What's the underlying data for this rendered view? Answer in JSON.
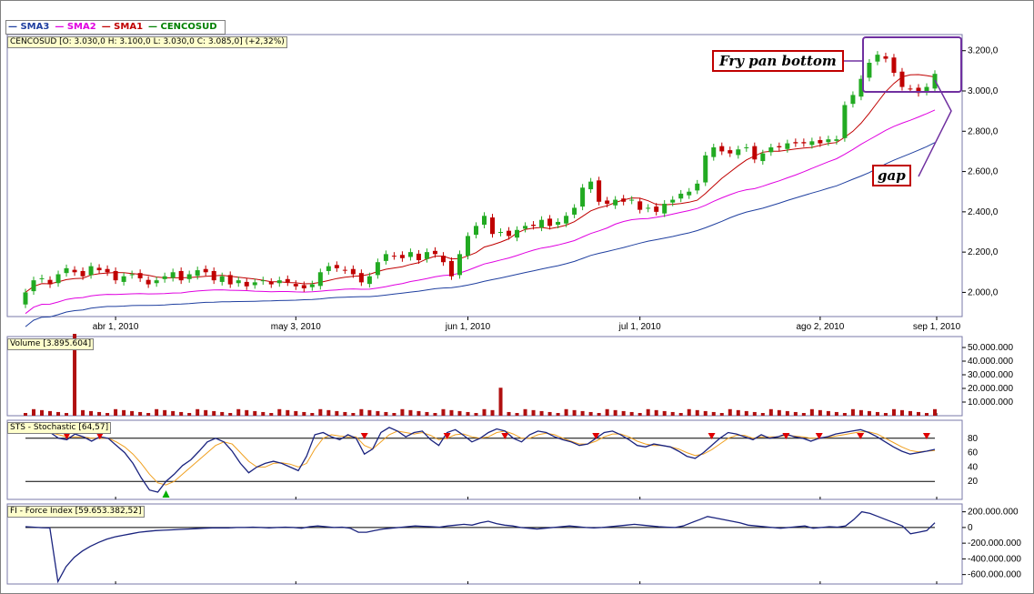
{
  "legend": [
    {
      "label": "SMA3",
      "color": "#1f3f9f"
    },
    {
      "label": "SMA2",
      "color": "#e000e0"
    },
    {
      "label": "SMA1",
      "color": "#c00000"
    },
    {
      "label": "CENCOSUD",
      "color": "#008000"
    }
  ],
  "panels": {
    "price_title": "CENCOSUD [O: 3.030,0  H: 3.100,0  L: 3.030,0  C: 3.085,0] (+2,32%)",
    "volume_title": "Volume [3.895.604]",
    "stoch_title": "STS - Stochastic [64,57]",
    "force_title": "FI - Force Index [59.653.382,52]"
  },
  "annotations": {
    "fry_pan": "Fry pan bottom",
    "gap": "gap"
  },
  "colors": {
    "up": "#22aa22",
    "down": "#c00000",
    "sma1": "#c00000",
    "sma2": "#e000e0",
    "sma3": "#1f3f9f",
    "stoch_k": "#1a237e",
    "stoch_d": "#f0a020",
    "force": "#1a237e",
    "volume": "#b01010",
    "annot_box": "#7030a0"
  },
  "chart_data": [
    {
      "type": "candlestick",
      "x_tick_labels": [
        "abr 1, 2010",
        "may 3, 2010",
        "jun 1, 2010",
        "jul 1, 2010",
        "ago 2, 2010",
        "sep 1, 2010"
      ],
      "y_tick_labels": [
        "2.000,0",
        "2.200,0",
        "2.400,0",
        "2.600,0",
        "2.800,0",
        "3.000,0",
        "3.200,0"
      ],
      "ylim": [
        1880,
        3280
      ],
      "closes": [
        2000,
        2060,
        2070,
        2040,
        2090,
        2120,
        2100,
        2080,
        2130,
        2110,
        2100,
        2060,
        2080,
        2090,
        2070,
        2040,
        2060,
        2080,
        2100,
        2060,
        2090,
        2110,
        2100,
        2060,
        2080,
        2040,
        2060,
        2030,
        2050,
        2060,
        2040,
        2060,
        2050,
        2030,
        2020,
        2040,
        2100,
        2130,
        2120,
        2110,
        2090,
        2050,
        2080,
        2150,
        2190,
        2180,
        2170,
        2200,
        2160,
        2200,
        2190,
        2150,
        2080,
        2190,
        2280,
        2330,
        2380,
        2290,
        2300,
        2280,
        2310,
        2330,
        2330,
        2360,
        2330,
        2350,
        2380,
        2420,
        2520,
        2550,
        2450,
        2440,
        2460,
        2450,
        2460,
        2410,
        2420,
        2400,
        2440,
        2460,
        2490,
        2500,
        2540,
        2680,
        2720,
        2700,
        2690,
        2710,
        2720,
        2660,
        2690,
        2720,
        2720,
        2740,
        2740,
        2740,
        2750,
        2740,
        2760,
        2760,
        2930,
        2980,
        3060,
        3140,
        3180,
        3160,
        3090,
        3020,
        3010,
        2990,
        3020,
        3085
      ],
      "volume_unit": "shares",
      "volume_ylim": [
        0,
        58000000
      ],
      "volume_tick_labels": [
        "10.000.000",
        "20.000.000",
        "30.000.000",
        "40.000.000",
        "50.000.000"
      ],
      "volume_spikes": [
        {
          "index": 6,
          "value": 60000000
        },
        {
          "index": 58,
          "value": 20500000
        }
      ],
      "stoch_ylim": [
        0,
        100
      ],
      "stoch_tick_labels": [
        "20",
        "40",
        "60",
        "80"
      ],
      "stoch_k": [
        95,
        93,
        90,
        88,
        80,
        78,
        86,
        82,
        76,
        82,
        80,
        70,
        60,
        45,
        25,
        8,
        5,
        20,
        30,
        42,
        50,
        62,
        75,
        80,
        75,
        62,
        45,
        32,
        40,
        45,
        48,
        45,
        40,
        35,
        55,
        85,
        88,
        82,
        78,
        85,
        80,
        58,
        65,
        88,
        95,
        90,
        82,
        88,
        90,
        78,
        70,
        88,
        92,
        84,
        75,
        80,
        88,
        93,
        90,
        80,
        75,
        85,
        90,
        88,
        82,
        78,
        75,
        70,
        72,
        80,
        88,
        90,
        85,
        78,
        70,
        68,
        72,
        70,
        68,
        62,
        55,
        52,
        60,
        70,
        80,
        88,
        86,
        82,
        78,
        85,
        80,
        82,
        86,
        82,
        80,
        76,
        80,
        82,
        86,
        88,
        90,
        92,
        88,
        82,
        75,
        68,
        62,
        58,
        60,
        62,
        64.57
      ],
      "stoch_d": [
        94,
        92,
        90,
        88,
        85,
        82,
        82,
        82,
        80,
        80,
        80,
        75,
        68,
        58,
        45,
        30,
        18,
        15,
        20,
        30,
        40,
        50,
        60,
        70,
        75,
        72,
        60,
        48,
        40,
        40,
        45,
        46,
        44,
        40,
        45,
        65,
        80,
        85,
        83,
        82,
        82,
        70,
        65,
        75,
        85,
        90,
        88,
        86,
        88,
        84,
        78,
        80,
        85,
        86,
        82,
        80,
        82,
        88,
        90,
        86,
        80,
        80,
        85,
        87,
        85,
        80,
        76,
        72,
        72,
        76,
        82,
        86,
        86,
        82,
        76,
        72,
        70,
        70,
        68,
        65,
        60,
        56,
        58,
        64,
        72,
        80,
        84,
        84,
        80,
        82,
        82,
        82,
        84,
        83,
        82,
        80,
        80,
        81,
        83,
        85,
        87,
        89,
        89,
        86,
        80,
        74,
        68,
        63,
        61,
        62,
        63
      ],
      "force_ylim": [
        -720000000,
        300000000
      ],
      "force_tick_labels": [
        "200.000.000",
        "0",
        "-200.000.000",
        "-400.000.000",
        "-600.000.000"
      ],
      "force": [
        10,
        5,
        -2,
        -5,
        -690,
        -500,
        -380,
        -300,
        -240,
        -190,
        -150,
        -120,
        -100,
        -80,
        -60,
        -50,
        -40,
        -35,
        -30,
        -25,
        -20,
        -15,
        -10,
        -5,
        -5,
        -5,
        0,
        0,
        5,
        0,
        -5,
        0,
        5,
        0,
        -10,
        10,
        20,
        10,
        0,
        5,
        -10,
        -60,
        -60,
        -40,
        -20,
        -10,
        0,
        10,
        20,
        15,
        10,
        5,
        20,
        30,
        40,
        30,
        60,
        80,
        50,
        30,
        20,
        0,
        -10,
        -20,
        -10,
        0,
        10,
        20,
        10,
        0,
        -5,
        0,
        10,
        20,
        30,
        40,
        30,
        20,
        10,
        5,
        0,
        20,
        60,
        100,
        140,
        120,
        100,
        80,
        60,
        30,
        20,
        10,
        0,
        -10,
        0,
        10,
        20,
        -10,
        0,
        10,
        5,
        20,
        100,
        200,
        180,
        140,
        100,
        60,
        20,
        -80,
        -60,
        -40,
        59.65
      ]
    }
  ]
}
